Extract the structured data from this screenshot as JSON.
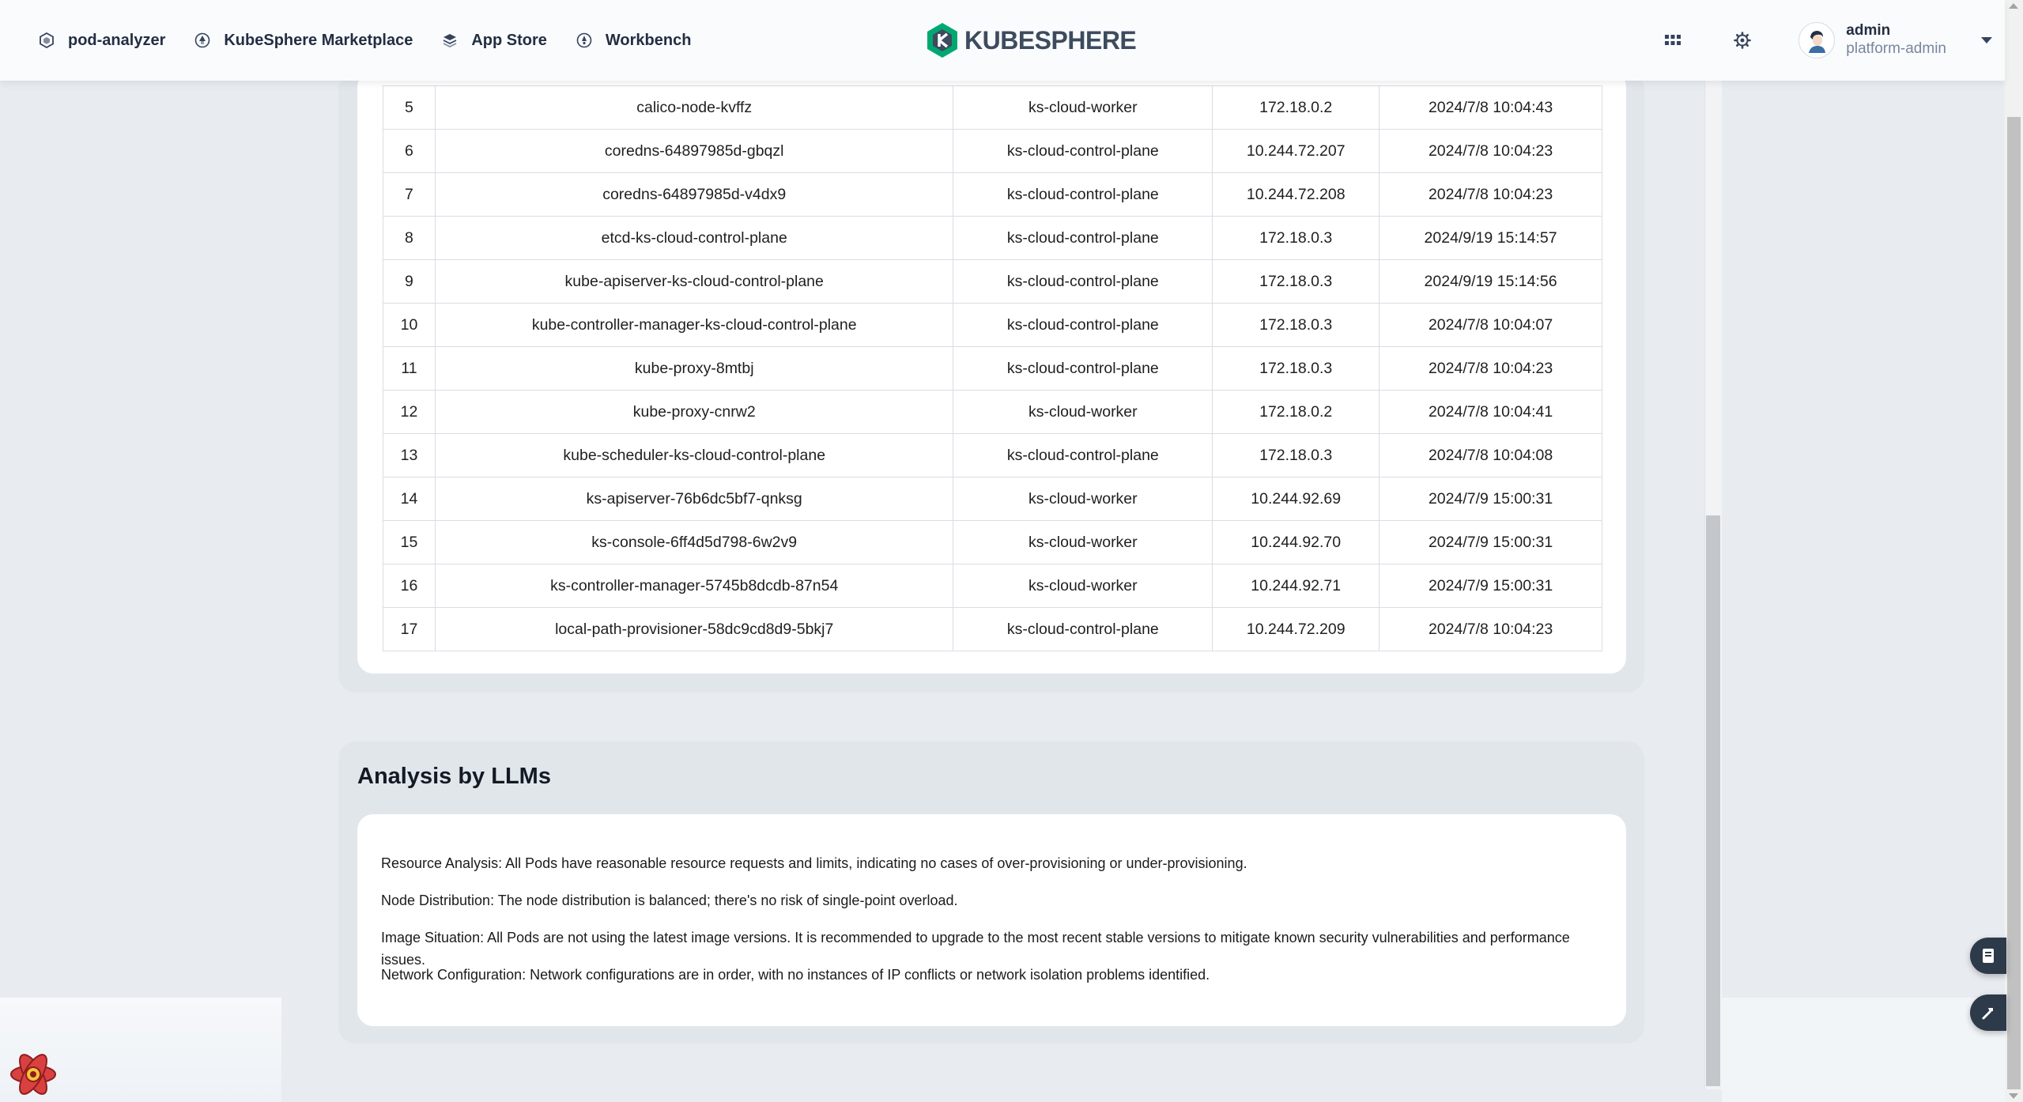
{
  "topbar": {
    "nav": [
      {
        "label": "pod-analyzer",
        "icon": "cube-icon"
      },
      {
        "label": "KubeSphere Marketplace",
        "icon": "marketplace-icon"
      },
      {
        "label": "App Store",
        "icon": "app-store-icon"
      },
      {
        "label": "Workbench",
        "icon": "workbench-icon"
      }
    ],
    "logo_text": "KUBESPHERE",
    "user": {
      "name": "admin",
      "role": "platform-admin"
    }
  },
  "pods_table": {
    "rows": [
      {
        "index": "5",
        "name": "calico-node-kvffz",
        "node": "ks-cloud-worker",
        "ip": "172.18.0.2",
        "created": "2024/7/8 10:04:43"
      },
      {
        "index": "6",
        "name": "coredns-64897985d-gbqzl",
        "node": "ks-cloud-control-plane",
        "ip": "10.244.72.207",
        "created": "2024/7/8 10:04:23"
      },
      {
        "index": "7",
        "name": "coredns-64897985d-v4dx9",
        "node": "ks-cloud-control-plane",
        "ip": "10.244.72.208",
        "created": "2024/7/8 10:04:23"
      },
      {
        "index": "8",
        "name": "etcd-ks-cloud-control-plane",
        "node": "ks-cloud-control-plane",
        "ip": "172.18.0.3",
        "created": "2024/9/19 15:14:57"
      },
      {
        "index": "9",
        "name": "kube-apiserver-ks-cloud-control-plane",
        "node": "ks-cloud-control-plane",
        "ip": "172.18.0.3",
        "created": "2024/9/19 15:14:56"
      },
      {
        "index": "10",
        "name": "kube-controller-manager-ks-cloud-control-plane",
        "node": "ks-cloud-control-plane",
        "ip": "172.18.0.3",
        "created": "2024/7/8 10:04:07"
      },
      {
        "index": "11",
        "name": "kube-proxy-8mtbj",
        "node": "ks-cloud-control-plane",
        "ip": "172.18.0.3",
        "created": "2024/7/8 10:04:23"
      },
      {
        "index": "12",
        "name": "kube-proxy-cnrw2",
        "node": "ks-cloud-worker",
        "ip": "172.18.0.2",
        "created": "2024/7/8 10:04:41"
      },
      {
        "index": "13",
        "name": "kube-scheduler-ks-cloud-control-plane",
        "node": "ks-cloud-control-plane",
        "ip": "172.18.0.3",
        "created": "2024/7/8 10:04:08"
      },
      {
        "index": "14",
        "name": "ks-apiserver-76b6dc5bf7-qnksg",
        "node": "ks-cloud-worker",
        "ip": "10.244.92.69",
        "created": "2024/7/9 15:00:31"
      },
      {
        "index": "15",
        "name": "ks-console-6ff4d5d798-6w2v9",
        "node": "ks-cloud-worker",
        "ip": "10.244.92.70",
        "created": "2024/7/9 15:00:31"
      },
      {
        "index": "16",
        "name": "ks-controller-manager-5745b8dcdb-87n54",
        "node": "ks-cloud-worker",
        "ip": "10.244.92.71",
        "created": "2024/7/9 15:00:31"
      },
      {
        "index": "17",
        "name": "local-path-provisioner-58dc9cd8d9-5bkj7",
        "node": "ks-cloud-control-plane",
        "ip": "10.244.72.209",
        "created": "2024/7/8 10:04:23"
      }
    ]
  },
  "analysis": {
    "title": "Analysis by LLMs",
    "lines": [
      "Resource Analysis: All Pods have reasonable resource requests and limits, indicating no cases of over-provisioning or under-provisioning.",
      "Node Distribution: The node distribution is balanced; there's no risk of single-point overload.",
      "Image Situation: All Pods are not using the latest image versions. It is recommended to upgrade to the most recent stable versions to mitigate known security vulnerabilities and performance issues.",
      "Network Configuration: Network configurations are in order, with no instances of IP conflicts or network isolation problems identified."
    ]
  },
  "colors": {
    "brand": "#3d4b5d",
    "logo_green": "#00a971",
    "page_bg": "#e8ecf1",
    "card_bg": "#ffffff"
  }
}
